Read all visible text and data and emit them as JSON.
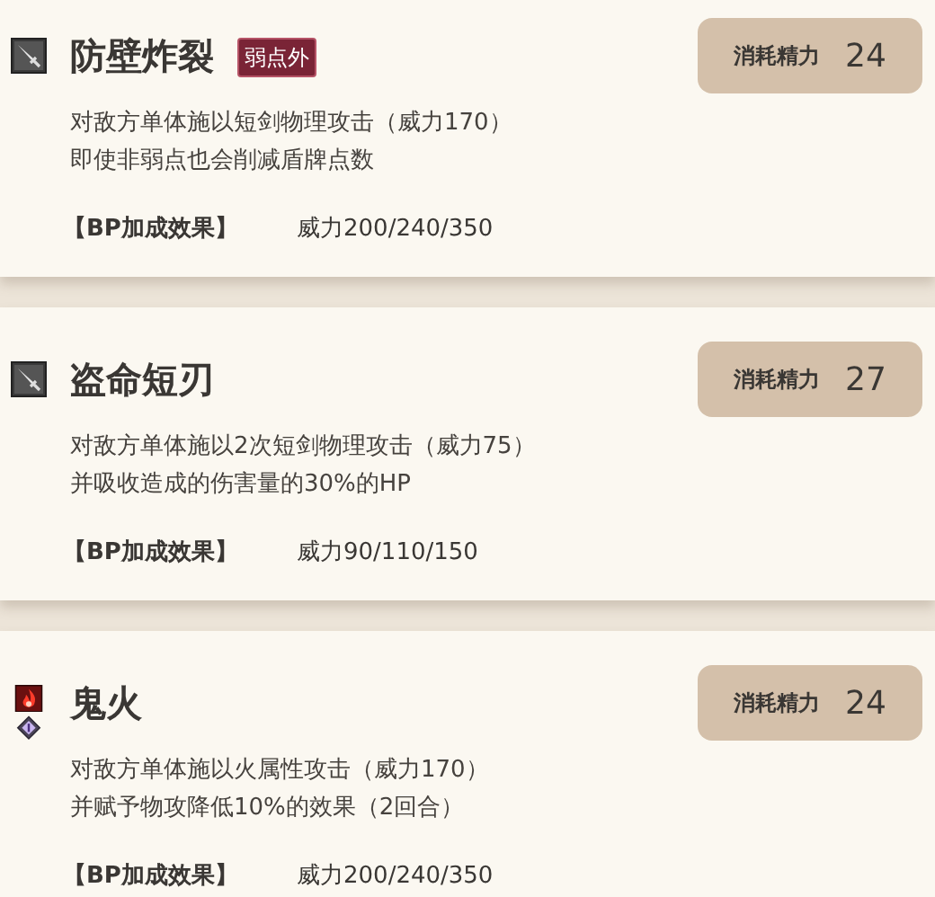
{
  "skills": [
    {
      "icons": [
        {
          "kind": "dagger"
        }
      ],
      "name": "防壁炸裂",
      "badge": "弱点外",
      "cost_label": "消耗精力",
      "cost": "24",
      "description": [
        "对敌方单体施以短剑物理攻击（威力170）",
        "即使非弱点也会削减盾牌点数"
      ],
      "bp_label": "【BP加成效果】",
      "bp_value": "威力200/240/350"
    },
    {
      "icons": [
        {
          "kind": "dagger"
        }
      ],
      "name": "盗命短刃",
      "cost_label": "消耗精力",
      "cost": "27",
      "description": [
        "对敌方单体施以2次短剑物理攻击（威力75）",
        "并吸收造成的伤害量的30%的HP"
      ],
      "bp_label": "【BP加成效果】",
      "bp_value": "威力90/110/150"
    },
    {
      "icons": [
        {
          "kind": "fire"
        },
        {
          "kind": "dark"
        }
      ],
      "name": "鬼火",
      "cost_label": "消耗精力",
      "cost": "24",
      "description": [
        "对敌方单体施以火属性攻击（威力170）",
        "并赋予物攻降低10%的效果（2回合）"
      ],
      "bp_label": "【BP加成效果】",
      "bp_value": "威力200/240/350"
    }
  ]
}
